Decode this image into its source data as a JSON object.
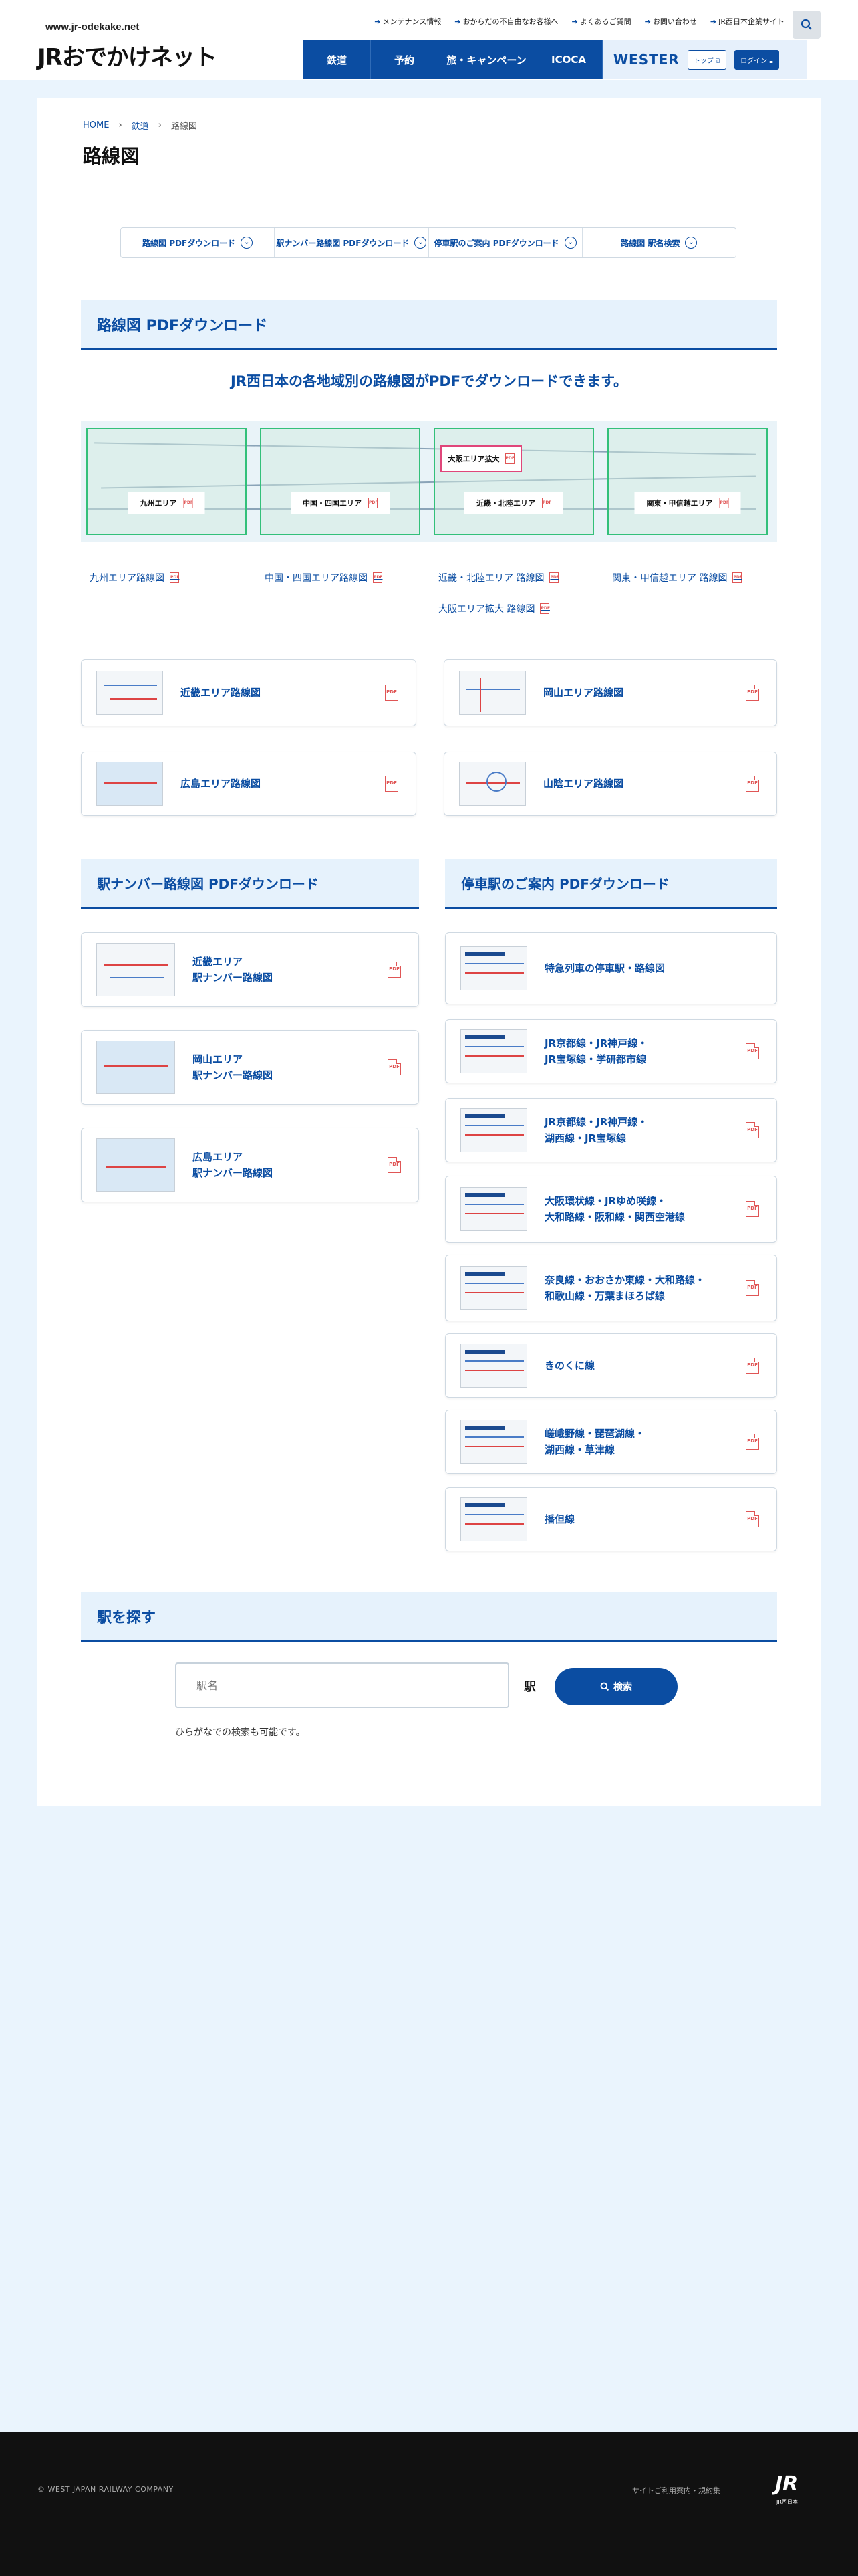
{
  "header": {
    "site_url": "www.jr-odekake.net",
    "logo": "JRおでかけネット",
    "util_links": [
      "メンテナンス情報",
      "おからだの不自由なお客様へ",
      "よくあるご質問",
      "お問い合わせ",
      "JR西日本企業サイト"
    ],
    "nav": [
      "鉄道",
      "予約",
      "旅・キャンペーン",
      "ICOCA"
    ],
    "wester": {
      "logo": "WESTER",
      "top_label": "トップ",
      "login_label": "ログイン"
    }
  },
  "breadcrumb": [
    "HOME",
    "鉄道",
    "路線図"
  ],
  "page_title": "路線図",
  "anchors": [
    "路線図 PDFダウンロード",
    "駅ナンバー路線図 PDFダウンロード",
    "停車駅のご案内 PDFダウンロード",
    "路線図 駅名検索"
  ],
  "route_map": {
    "heading": "路線図 PDFダウンロード",
    "lead": "JR西日本の各地域別の路線図がPDFでダウンロードできます。",
    "map_labels": [
      "九州エリア",
      "中国・四国エリア",
      "大阪エリア拡大",
      "近畿・北陸エリア",
      "関東・甲信越エリア"
    ],
    "links": [
      "九州エリア路線図",
      "中国・四国エリア路線図",
      "近畿・北陸エリア 路線図",
      "関東・甲信越エリア 路線図",
      "大阪エリア拡大 路線図"
    ],
    "cards": [
      "近畿エリア路線図",
      "岡山エリア路線図",
      "広島エリア路線図",
      "山陰エリア路線図"
    ]
  },
  "station_number": {
    "heading": "駅ナンバー路線図 PDFダウンロード",
    "cards": [
      {
        "line1": "近畿エリア",
        "line2": "駅ナンバー路線図"
      },
      {
        "line1": "岡山エリア",
        "line2": "駅ナンバー路線図"
      },
      {
        "line1": "広島エリア",
        "line2": "駅ナンバー路線図"
      }
    ]
  },
  "stops": {
    "heading": "停車駅のご案内 PDFダウンロード",
    "cards": [
      {
        "line1": "特急列車の停車駅・路線図",
        "line2": ""
      },
      {
        "line1": "JR京都線・JR神戸線・",
        "line2": "JR宝塚線・学研都市線"
      },
      {
        "line1": "JR京都線・JR神戸線・",
        "line2": "湖西線・JR宝塚線"
      },
      {
        "line1": "大阪環状線・JRゆめ咲線・",
        "line2": "大和路線・阪和線・関西空港線"
      },
      {
        "line1": "奈良線・おおさか東線・大和路線・",
        "line2": "和歌山線・万葉まほろば線"
      },
      {
        "line1": "きのくに線",
        "line2": ""
      },
      {
        "line1": "嵯峨野線・琵琶湖線・",
        "line2": "湖西線・草津線"
      },
      {
        "line1": "播但線",
        "line2": ""
      }
    ]
  },
  "station_search": {
    "heading": "駅を探す",
    "placeholder": "駅名",
    "suffix": "駅",
    "button": "検索",
    "hint": "ひらがなでの検索も可能です。"
  },
  "footer": {
    "copyright": "© WEST JAPAN RAILWAY COMPANY",
    "terms": "サイトご利用案内・規約集",
    "logo": "JR",
    "logo_sub": "JR西日本"
  },
  "colors": {
    "accent": "#0b4da2",
    "section_bg": "#e6f2fc",
    "page_bg": "#eaf4fd",
    "map_frame": "#33c07a",
    "pdf_red": "#e05656"
  }
}
